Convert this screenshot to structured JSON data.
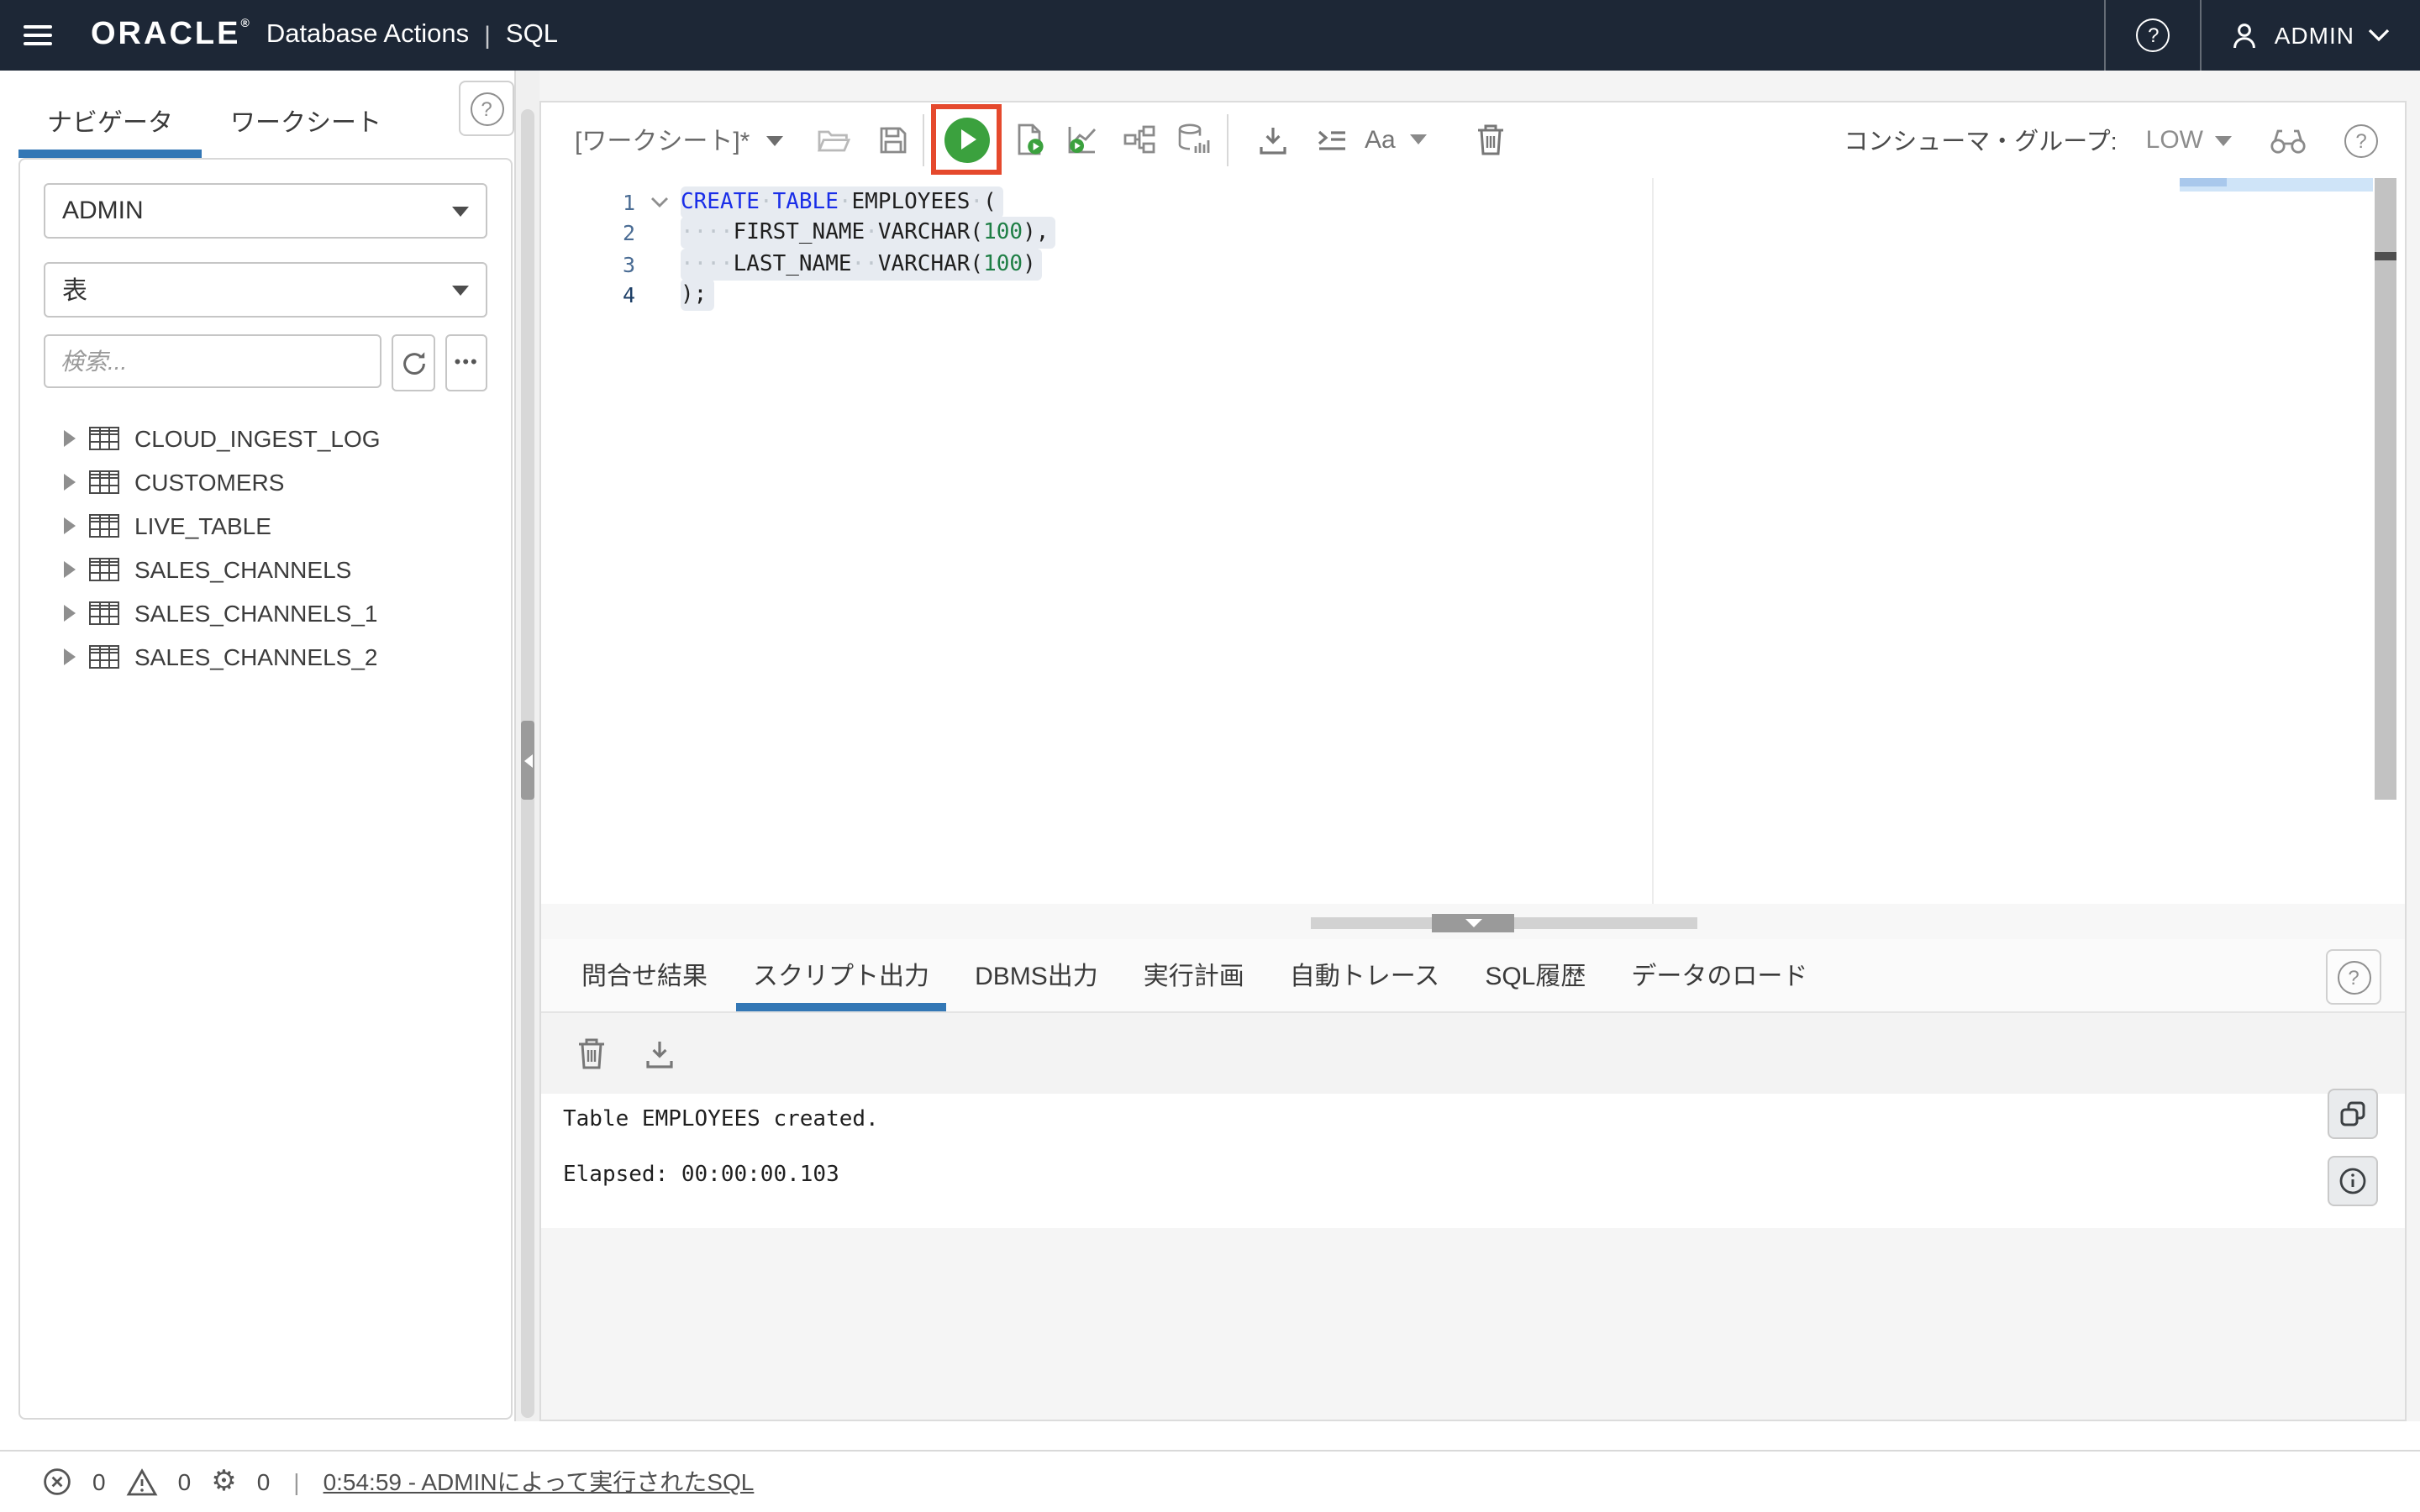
{
  "header": {
    "brand": "ORACLE",
    "registered": "®",
    "product": "Database Actions",
    "divider": "|",
    "module": "SQL",
    "user_label": "ADMIN"
  },
  "sidebar": {
    "tabs": [
      {
        "label": "ナビゲータ",
        "active": true
      },
      {
        "label": "ワークシート",
        "active": false
      }
    ],
    "schema_value": "ADMIN",
    "object_type_value": "表",
    "search_placeholder": "検索...",
    "tree_items": [
      {
        "label": "CLOUD_INGEST_LOG"
      },
      {
        "label": "CUSTOMERS"
      },
      {
        "label": "LIVE_TABLE"
      },
      {
        "label": "SALES_CHANNELS"
      },
      {
        "label": "SALES_CHANNELS_1"
      },
      {
        "label": "SALES_CHANNELS_2"
      }
    ]
  },
  "toolbar": {
    "worksheet_title": "[ワークシート]*",
    "font_button_label": "Aa",
    "consumer_group_label": "コンシューマ・グループ:",
    "consumer_group_value": "LOW"
  },
  "editor": {
    "lines": [
      {
        "num": "1",
        "fold": true,
        "selected": true,
        "active": false,
        "tokens": [
          {
            "c": "kw",
            "t": "CREATE"
          },
          {
            "c": "ws",
            "t": "·"
          },
          {
            "c": "kw",
            "t": "TABLE"
          },
          {
            "c": "ws",
            "t": "·"
          },
          {
            "c": "pl",
            "t": "EMPLOYEES"
          },
          {
            "c": "ws",
            "t": "·"
          },
          {
            "c": "pl",
            "t": "("
          }
        ]
      },
      {
        "num": "2",
        "fold": false,
        "selected": true,
        "active": false,
        "tokens": [
          {
            "c": "ws",
            "t": "····"
          },
          {
            "c": "pl",
            "t": "FIRST_NAME"
          },
          {
            "c": "ws",
            "t": "·"
          },
          {
            "c": "pl",
            "t": "VARCHAR("
          },
          {
            "c": "nu",
            "t": "100"
          },
          {
            "c": "pl",
            "t": "),"
          }
        ]
      },
      {
        "num": "3",
        "fold": false,
        "selected": true,
        "active": false,
        "tokens": [
          {
            "c": "ws",
            "t": "····"
          },
          {
            "c": "pl",
            "t": "LAST_NAME"
          },
          {
            "c": "ws",
            "t": "··"
          },
          {
            "c": "pl",
            "t": "VARCHAR("
          },
          {
            "c": "nu",
            "t": "100"
          },
          {
            "c": "pl",
            "t": ")"
          }
        ]
      },
      {
        "num": "4",
        "fold": false,
        "selected": true,
        "active": true,
        "tokens": [
          {
            "c": "pl",
            "t": ");"
          }
        ]
      }
    ]
  },
  "results": {
    "tabs": [
      {
        "label": "問合せ結果",
        "active": false
      },
      {
        "label": "スクリプト出力",
        "active": true
      },
      {
        "label": "DBMS出力",
        "active": false
      },
      {
        "label": "実行計画",
        "active": false
      },
      {
        "label": "自動トレース",
        "active": false
      },
      {
        "label": "SQL履歴",
        "active": false
      },
      {
        "label": "データのロード",
        "active": false
      }
    ],
    "output_lines": [
      "Table EMPLOYEES created.",
      "Elapsed: 00:00:00.103"
    ]
  },
  "statusbar": {
    "error_count": "0",
    "warning_count": "0",
    "process_count": "0",
    "separator": "|",
    "history_link": "0:54:59 - ADMINによって実行されたSQL"
  },
  "icons": {
    "ellipsis": "•••",
    "gear": "⚙"
  },
  "colors": {
    "header_bg": "#1d2736",
    "accent_blue": "#3377b5",
    "run_green": "#3ba13e",
    "highlight_red": "#e5492d",
    "keyword_blue": "#1a2ee8",
    "number_green": "#1e7e45",
    "selection_bg": "#e7ebf1"
  }
}
